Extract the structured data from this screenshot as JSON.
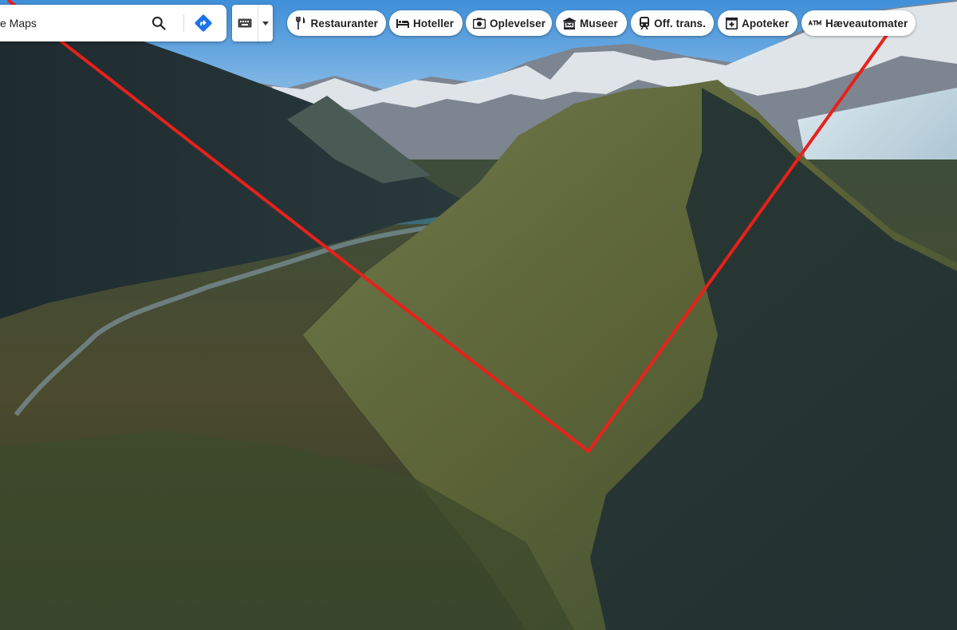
{
  "search": {
    "value": "e Maps",
    "search_icon": "search-icon",
    "directions_icon": "directions-icon"
  },
  "input_tools": {
    "keyboard_icon": "keyboard-icon",
    "dropdown_icon": "caret-down-icon"
  },
  "categories": [
    {
      "label": "Restauranter",
      "icon": "fork-knife-icon"
    },
    {
      "label": "Hoteller",
      "icon": "bed-icon"
    },
    {
      "label": "Oplevelser",
      "icon": "camera-icon"
    },
    {
      "label": "Museer",
      "icon": "museum-icon"
    },
    {
      "label": "Off. trans.",
      "icon": "train-icon"
    },
    {
      "label": "Apoteker",
      "icon": "pharmacy-icon"
    },
    {
      "label": "Hæveautomater",
      "icon": "atm-icon"
    }
  ],
  "colors": {
    "directions": "#1a73e8",
    "annotation_line": "#e8211a"
  }
}
